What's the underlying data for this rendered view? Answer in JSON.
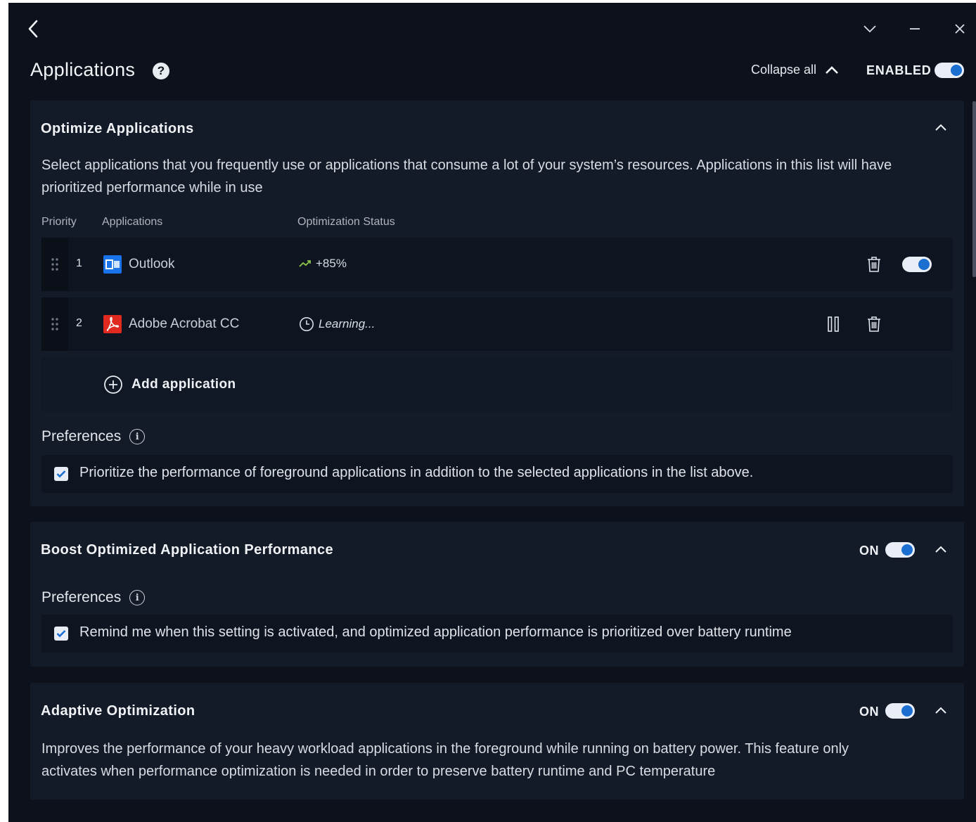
{
  "window": {
    "back_icon": "chevron-left-icon",
    "minimize_icon": "minus-icon",
    "dropdown_icon": "chevron-down-icon",
    "close_icon": "close-icon"
  },
  "header": {
    "title": "Applications",
    "help_glyph": "?",
    "collapse_all_label": "Collapse all",
    "enabled_label": "ENABLED",
    "enabled": true
  },
  "optimize": {
    "title": "Optimize Applications",
    "description": "Select applications that you frequently use or applications that consume a lot of your system’s resources. Applications in this list will have prioritized performance while in use",
    "columns": {
      "priority": "Priority",
      "applications": "Applications",
      "status": "Optimization Status"
    },
    "apps": [
      {
        "priority": "1",
        "name": "Outlook",
        "icon": "outlook-icon",
        "status": "+85%",
        "status_icon": "trend-up-icon",
        "enabled": true
      },
      {
        "priority": "2",
        "name": "Adobe Acrobat CC",
        "icon": "acrobat-icon",
        "status": "Learning...",
        "status_icon": "clock-icon",
        "paused": true
      }
    ],
    "add_label": "Add application",
    "preferences_label": "Preferences",
    "preference_text": "Prioritize the performance of foreground applications in addition to the selected applications in the list above.",
    "preference_checked": true
  },
  "boost": {
    "title": "Boost Optimized Application Performance",
    "on_label": "ON",
    "enabled": true,
    "preferences_label": "Preferences",
    "preference_text": "Remind me when this setting is activated, and optimized application performance is prioritized over battery runtime",
    "preference_checked": true
  },
  "adaptive": {
    "title": "Adaptive Optimization",
    "on_label": "ON",
    "enabled": true,
    "description": "Improves the performance of your heavy workload applications in the foreground while running on battery power. This feature only activates when performance optimization is needed in order to preserve battery runtime and PC temperature"
  },
  "colors": {
    "accent": "#1b6fd1",
    "background": "#0c111b",
    "card": "#141b28",
    "row": "#0f1520",
    "trend": "#8bc34a"
  }
}
